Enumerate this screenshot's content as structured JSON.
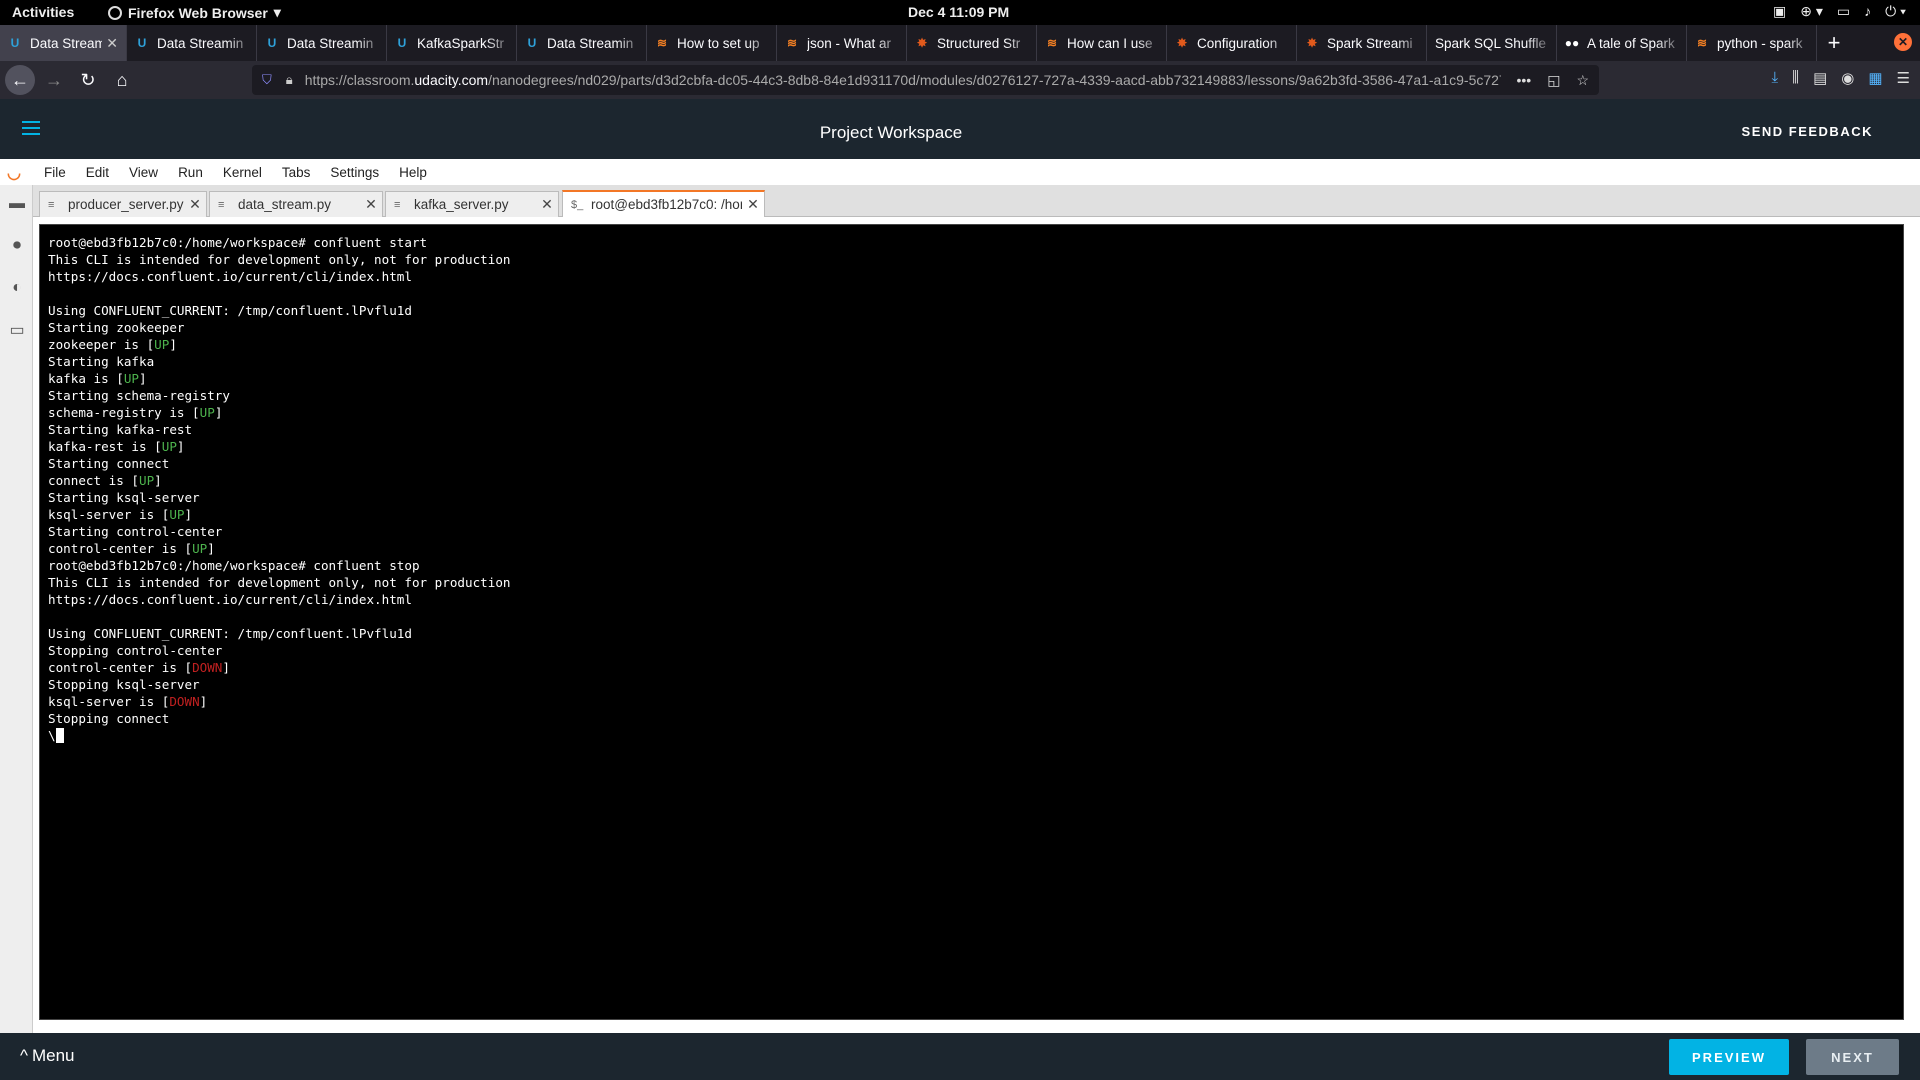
{
  "system": {
    "activities": "Activities",
    "app_name": "Firefox Web Browser",
    "clock": "Dec 4  11:09 PM"
  },
  "browser": {
    "tabs": [
      {
        "label": "Data Stream",
        "icon": "udacity-icon",
        "active": true
      },
      {
        "label": "Data Streamin",
        "icon": "udacity-icon"
      },
      {
        "label": "Data Streamin",
        "icon": "udacity-icon"
      },
      {
        "label": "KafkaSparkStr",
        "icon": "udacity-icon"
      },
      {
        "label": "Data Streamin",
        "icon": "udacity-icon"
      },
      {
        "label": "How to set up",
        "icon": "stackoverflow-icon"
      },
      {
        "label": "json - What ar",
        "icon": "stackoverflow-icon"
      },
      {
        "label": "Structured Str",
        "icon": "spark-icon"
      },
      {
        "label": "How can I use",
        "icon": "stackoverflow-icon"
      },
      {
        "label": "Configuration",
        "icon": "spark-icon"
      },
      {
        "label": "Spark Streami",
        "icon": "spark-icon"
      },
      {
        "label": "Spark SQL Shuffle",
        "icon": "none"
      },
      {
        "label": "A tale of Spark",
        "icon": "medium-icon"
      },
      {
        "label": "python - spark",
        "icon": "stackoverflow-icon"
      }
    ],
    "url_prefix": "https://classroom.",
    "url_domain": "udacity.com",
    "url_rest": "/nanodegrees/nd029/parts/d3d2cbfa-dc05-44c3-8db8-84e1d931170d/modules/d0276127-727a-4339-aacd-abb732149883/lessons/9a62b3fd-3586-47a1-a1c9-5c727"
  },
  "udacity": {
    "title": "Project Workspace",
    "feedback": "SEND FEEDBACK",
    "menu": "Menu",
    "preview": "PREVIEW",
    "next": "NEXT"
  },
  "jupyter": {
    "menu": [
      "File",
      "Edit",
      "View",
      "Run",
      "Kernel",
      "Tabs",
      "Settings",
      "Help"
    ],
    "tabs": [
      {
        "label": "producer_server.py"
      },
      {
        "label": "data_stream.py"
      },
      {
        "label": "kafka_server.py"
      },
      {
        "label": "root@ebd3fb12b7c0: /hom"
      }
    ]
  },
  "terminal": {
    "lines": [
      {
        "text": "root@ebd3fb12b7c0:/home/workspace# confluent start"
      },
      {
        "text": "This CLI is intended for development only, not for production"
      },
      {
        "text": "https://docs.confluent.io/current/cli/index.html"
      },
      {
        "text": ""
      },
      {
        "text": "Using CONFLUENT_CURRENT: /tmp/confluent.lPvflu1d"
      },
      {
        "text": "Starting zookeeper"
      },
      {
        "text": "zookeeper is [",
        "status": "UP",
        "tail": "]"
      },
      {
        "text": "Starting kafka"
      },
      {
        "text": "kafka is [",
        "status": "UP",
        "tail": "]"
      },
      {
        "text": "Starting schema-registry"
      },
      {
        "text": "schema-registry is [",
        "status": "UP",
        "tail": "]"
      },
      {
        "text": "Starting kafka-rest"
      },
      {
        "text": "kafka-rest is [",
        "status": "UP",
        "tail": "]"
      },
      {
        "text": "Starting connect"
      },
      {
        "text": "connect is [",
        "status": "UP",
        "tail": "]"
      },
      {
        "text": "Starting ksql-server"
      },
      {
        "text": "ksql-server is [",
        "status": "UP",
        "tail": "]"
      },
      {
        "text": "Starting control-center"
      },
      {
        "text": "control-center is [",
        "status": "UP",
        "tail": "]"
      },
      {
        "text": "root@ebd3fb12b7c0:/home/workspace# confluent stop"
      },
      {
        "text": "This CLI is intended for development only, not for production"
      },
      {
        "text": "https://docs.confluent.io/current/cli/index.html"
      },
      {
        "text": ""
      },
      {
        "text": "Using CONFLUENT_CURRENT: /tmp/confluent.lPvflu1d"
      },
      {
        "text": "Stopping control-center"
      },
      {
        "text": "control-center is [",
        "status": "DOWN",
        "tail": "]"
      },
      {
        "text": "Stopping ksql-server"
      },
      {
        "text": "ksql-server is [",
        "status": "DOWN",
        "tail": "]"
      },
      {
        "text": "Stopping connect"
      },
      {
        "text": "\\",
        "cursor": true
      }
    ],
    "colors": {
      "up": "#4db34d",
      "down": "#c02020"
    }
  }
}
